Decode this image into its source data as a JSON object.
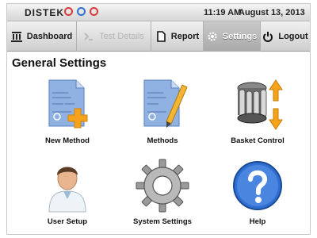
{
  "brand": {
    "logo_text": "DISTEK"
  },
  "status": {
    "indicators": [
      {
        "name": "status-light-1",
        "color": "#d63a3a"
      },
      {
        "name": "status-light-2",
        "color": "#2f6fd1"
      },
      {
        "name": "status-light-3",
        "color": "#d63a3a"
      }
    ],
    "time": "11:19 AM",
    "date": "August 13, 2013"
  },
  "nav": {
    "dashboard": {
      "label": "Dashboard",
      "icon": "dashboard-icon"
    },
    "test_details": {
      "label": "Test Details",
      "icon": "test-details-icon",
      "disabled": true
    },
    "report": {
      "label": "Report",
      "icon": "report-icon"
    },
    "settings": {
      "label": "Settings",
      "icon": "gear-icon",
      "active": true
    },
    "logout": {
      "label": "Logout",
      "icon": "power-icon"
    }
  },
  "page": {
    "title": "General Settings"
  },
  "tiles": {
    "new_method": {
      "label": "New Method",
      "icon": "new-method-icon"
    },
    "methods": {
      "label": "Methods",
      "icon": "methods-icon"
    },
    "basket_control": {
      "label": "Basket Control",
      "icon": "basket-control-icon"
    },
    "user_setup": {
      "label": "User Setup",
      "icon": "user-icon"
    },
    "system_settings": {
      "label": "System Settings",
      "icon": "gear-icon"
    },
    "help": {
      "label": "Help",
      "icon": "help-icon"
    }
  },
  "colors": {
    "accent_blue": "#2f6fd1",
    "accent_orange": "#f5a623",
    "status_red": "#d63a3a"
  }
}
